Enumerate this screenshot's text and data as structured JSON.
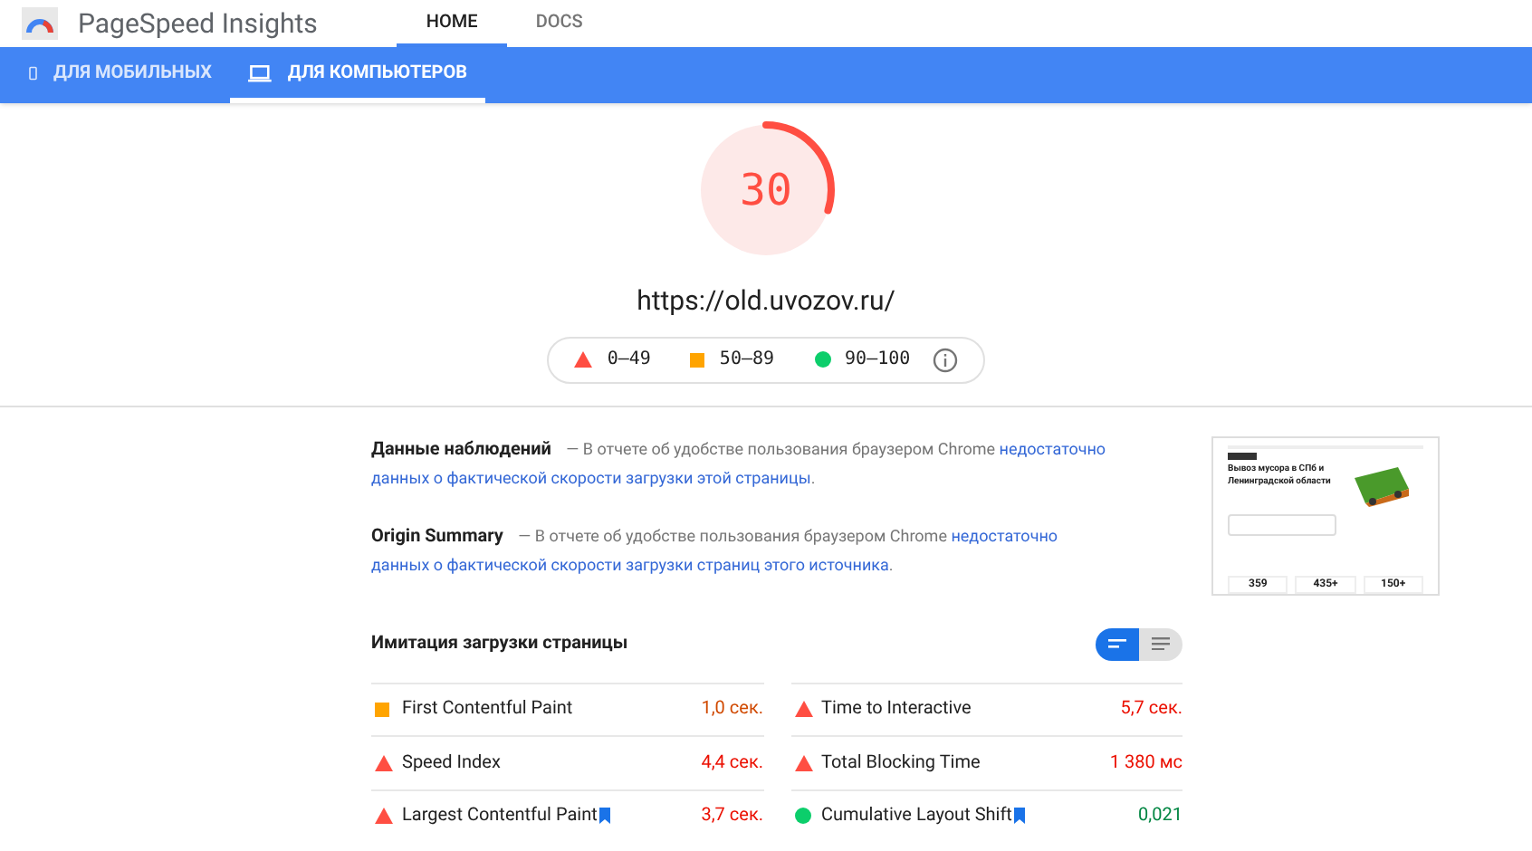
{
  "app": {
    "title": "PageSpeed Insights"
  },
  "nav": [
    {
      "label": "HOME",
      "selected": true
    },
    {
      "label": "DOCS",
      "selected": false
    }
  ],
  "device_tabs": [
    {
      "label": "ДЛЯ МОБИЛЬНЫХ",
      "kind": "mobile",
      "selected": false
    },
    {
      "label": "ДЛЯ КОМПЬЮТЕРОВ",
      "kind": "desktop",
      "selected": true
    }
  ],
  "score": {
    "value": "30",
    "kind": "fail"
  },
  "url": "https://old.uvozov.ru/",
  "legend": [
    {
      "kind": "fail",
      "label": "0–49"
    },
    {
      "kind": "average",
      "label": "50–89"
    },
    {
      "kind": "pass",
      "label": "90–100"
    }
  ],
  "notices": [
    {
      "title": "Данные наблюдений",
      "text": "— В отчете об удобстве пользования браузером Chrome",
      "link": "недостаточно данных о фактической скорости загрузки этой страницы",
      "end": "."
    },
    {
      "title": "Origin Summary",
      "text": "— В отчете об удобстве пользования браузером Chrome",
      "link": "недостаточно данных о фактической скорости загрузки страниц этого источника",
      "end": "."
    }
  ],
  "thumbnail": {
    "heading": "Вывоз мусора в СПб и Ленинградской области",
    "stats": [
      "359",
      "435+",
      "150+"
    ]
  },
  "lab": {
    "title": "Имитация загрузки страницы",
    "view_toggle": [
      {
        "kind": "compact",
        "selected": true
      },
      {
        "kind": "list",
        "selected": false
      }
    ],
    "metrics": [
      {
        "name": "First Contentful Paint",
        "value": "1,0 сек.",
        "kind": "average",
        "flagged": false
      },
      {
        "name": "Time to Interactive",
        "value": "5,7 сек.",
        "kind": "fail",
        "flagged": false
      },
      {
        "name": "Speed Index",
        "value": "4,4 сек.",
        "kind": "fail",
        "flagged": false
      },
      {
        "name": "Total Blocking Time",
        "value": "1 380 мс",
        "kind": "fail",
        "flagged": false
      },
      {
        "name": "Largest Contentful Paint",
        "value": "3,7 сек.",
        "kind": "fail",
        "flagged": true
      },
      {
        "name": "Cumulative Layout Shift",
        "value": "0,021",
        "kind": "pass",
        "flagged": true
      }
    ]
  }
}
